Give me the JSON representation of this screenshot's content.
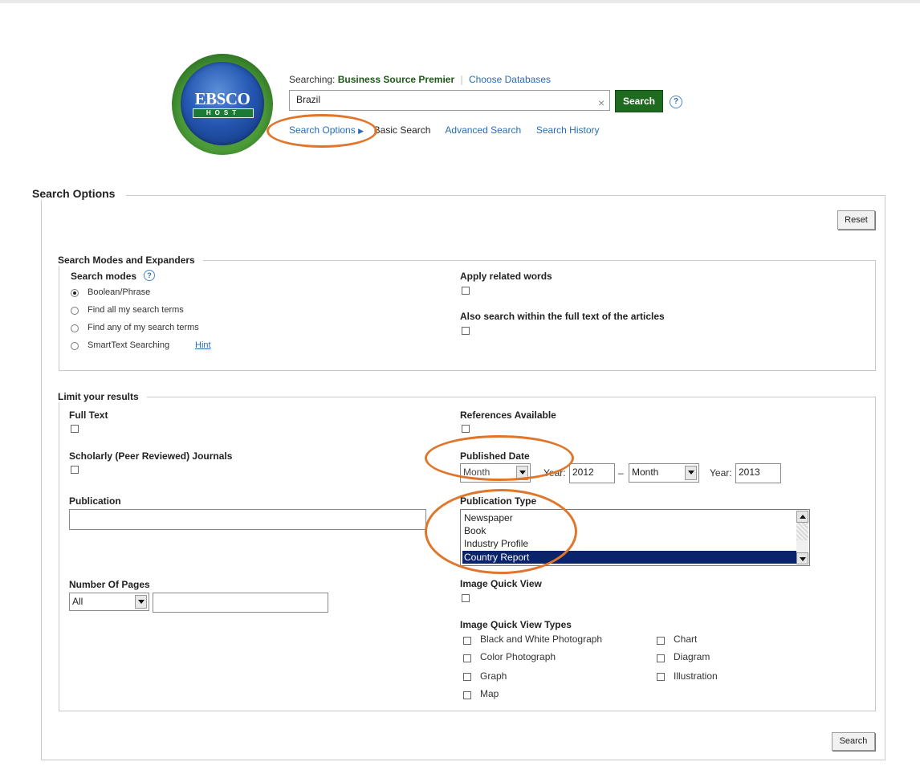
{
  "header": {
    "logo_text": "EBSCO",
    "logo_subtext": "HOST",
    "searching_label": "Searching:",
    "database_name": "Business Source Premier",
    "choose_databases": "Choose Databases",
    "search_value": "Brazil",
    "clear_symbol": "×",
    "search_button": "Search",
    "help_symbol": "?",
    "nav": {
      "search_options": "Search Options",
      "basic_search": "Basic Search",
      "advanced_search": "Advanced Search",
      "search_history": "Search History"
    }
  },
  "options_panel": {
    "title": "Search Options",
    "reset_button": "Reset",
    "search_button": "Search",
    "modes_section": {
      "title": "Search Modes and Expanders",
      "search_modes_label": "Search modes",
      "modes": [
        {
          "label": "Boolean/Phrase",
          "selected": true
        },
        {
          "label": "Find all my search terms",
          "selected": false
        },
        {
          "label": "Find any of my search terms",
          "selected": false
        },
        {
          "label": "SmartText Searching",
          "selected": false
        }
      ],
      "hint_link": "Hint",
      "apply_related_words": "Apply related words",
      "also_search_full_text": "Also search within the full text of the articles"
    },
    "limits_section": {
      "title": "Limit your results",
      "full_text": "Full Text",
      "scholarly": "Scholarly (Peer Reviewed) Journals",
      "publication": "Publication",
      "number_of_pages": "Number Of Pages",
      "pages_select": "All",
      "references_available": "References Available",
      "published_date": "Published Date",
      "month_placeholder": "Month",
      "year_label": "Year:",
      "year_from": "2012",
      "dash": "–",
      "year_to": "2013",
      "publication_type": "Publication Type",
      "publication_types": [
        {
          "label": "Newspaper",
          "selected": false
        },
        {
          "label": "Book",
          "selected": false
        },
        {
          "label": "Industry Profile",
          "selected": false
        },
        {
          "label": "Country Report",
          "selected": true
        }
      ],
      "image_quick_view": "Image Quick View",
      "image_quick_view_types": "Image Quick View Types",
      "image_types_left": [
        "Black and White Photograph",
        "Color Photograph",
        "Graph",
        "Map"
      ],
      "image_types_right": [
        "Chart",
        "Diagram",
        "Illustration"
      ]
    }
  },
  "annotation_color": "#e0762b",
  "accent_green": "#1e6a1e",
  "link_color": "#2a6cb5"
}
